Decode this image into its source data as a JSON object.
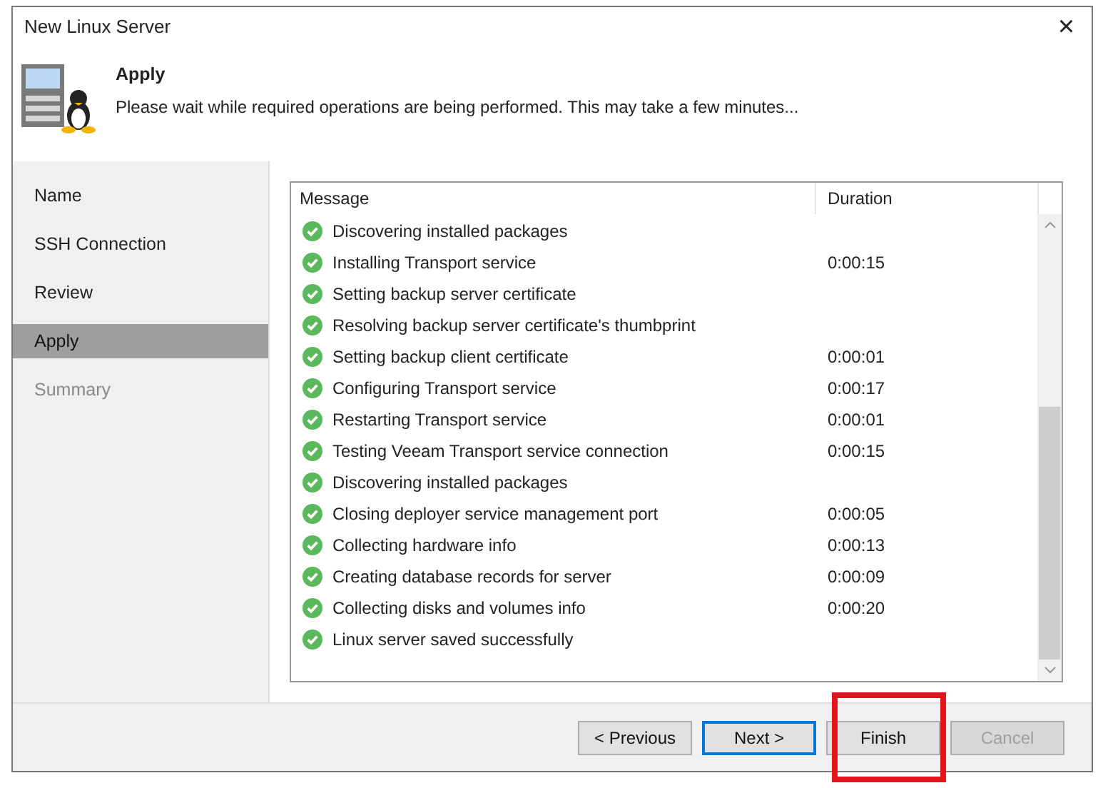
{
  "window": {
    "title": "New Linux Server",
    "close": "×"
  },
  "header": {
    "title": "Apply",
    "description": "Please wait while required operations are being performed. This may take a few minutes..."
  },
  "sidebar": {
    "items": [
      {
        "label": "Name",
        "selected": false,
        "disabled": false
      },
      {
        "label": "SSH Connection",
        "selected": false,
        "disabled": false
      },
      {
        "label": "Review",
        "selected": false,
        "disabled": false
      },
      {
        "label": "Apply",
        "selected": true,
        "disabled": false
      },
      {
        "label": "Summary",
        "selected": false,
        "disabled": true
      }
    ]
  },
  "table": {
    "columns": [
      "Message",
      "Duration"
    ],
    "rows": [
      {
        "message": "Discovering installed packages",
        "done": true
      },
      {
        "message": "Installing Transport service",
        "duration": "0:00:15",
        "done": true
      },
      {
        "message": "Setting backup server certificate",
        "done": true
      },
      {
        "message": "Resolving backup server certificate's thumbprint",
        "done": true
      },
      {
        "message": "Setting backup client certificate",
        "duration": "0:00:01",
        "done": true
      },
      {
        "message": "Configuring Transport service",
        "duration": "0:00:17",
        "done": true
      },
      {
        "message": "Restarting Transport service",
        "duration": "0:00:01",
        "done": true
      },
      {
        "message": "Testing Veeam Transport service connection",
        "duration": "0:00:15",
        "done": true
      },
      {
        "message": "Discovering installed packages",
        "done": true
      },
      {
        "message": "Closing deployer service management port",
        "duration": "0:00:05",
        "done": true
      },
      {
        "message": "Collecting hardware info",
        "duration": "0:00:13",
        "done": true
      },
      {
        "message": "Creating database records for server",
        "duration": "0:00:09",
        "done": true
      },
      {
        "message": "Collecting disks and volumes info",
        "duration": "0:00:20",
        "done": true
      },
      {
        "message": "Linux server saved successfully",
        "done": true
      }
    ]
  },
  "buttons": [
    {
      "label": "< Previous",
      "disabled": false,
      "focused": false
    },
    {
      "label": "Next >",
      "disabled": false,
      "focused": true
    },
    {
      "label": "Finish",
      "disabled": false,
      "focused": false,
      "highlighted": true
    },
    {
      "label": "Cancel",
      "disabled": true,
      "focused": false
    }
  ]
}
